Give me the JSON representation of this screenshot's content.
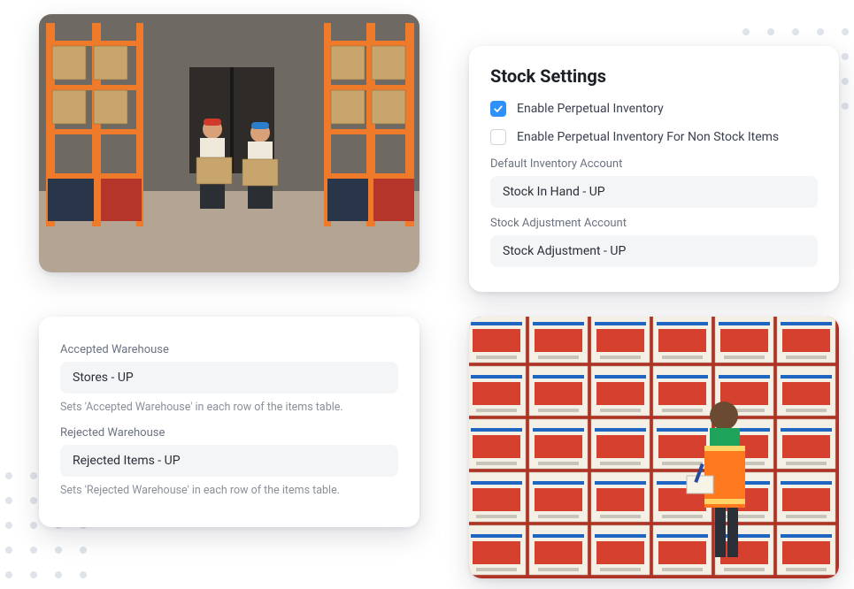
{
  "stock_settings": {
    "title": "Stock Settings",
    "enable_perpetual_label": "Enable Perpetual Inventory",
    "enable_perpetual_checked": true,
    "enable_perpetual_nonstock_label": "Enable Perpetual Inventory For Non Stock Items",
    "enable_perpetual_nonstock_checked": false,
    "default_inventory_account_label": "Default Inventory Account",
    "default_inventory_account_value": "Stock In Hand - UP",
    "stock_adjustment_account_label": "Stock Adjustment Account",
    "stock_adjustment_account_value": "Stock Adjustment - UP"
  },
  "wh_settings": {
    "accepted_label": "Accepted Warehouse",
    "accepted_value": "Stores - UP",
    "accepted_hint": "Sets 'Accepted Warehouse' in each row of the items table.",
    "rejected_label": "Rejected Warehouse",
    "rejected_value": "Rejected Items - UP",
    "rejected_hint": "Sets 'Rejected Warehouse' in each row of the items table."
  },
  "images": {
    "warehouse_alt": "Two workers carrying boxes in a warehouse aisle",
    "stockroom_alt": "Worker in hi-vis vest taking inventory against stacked product boxes"
  }
}
